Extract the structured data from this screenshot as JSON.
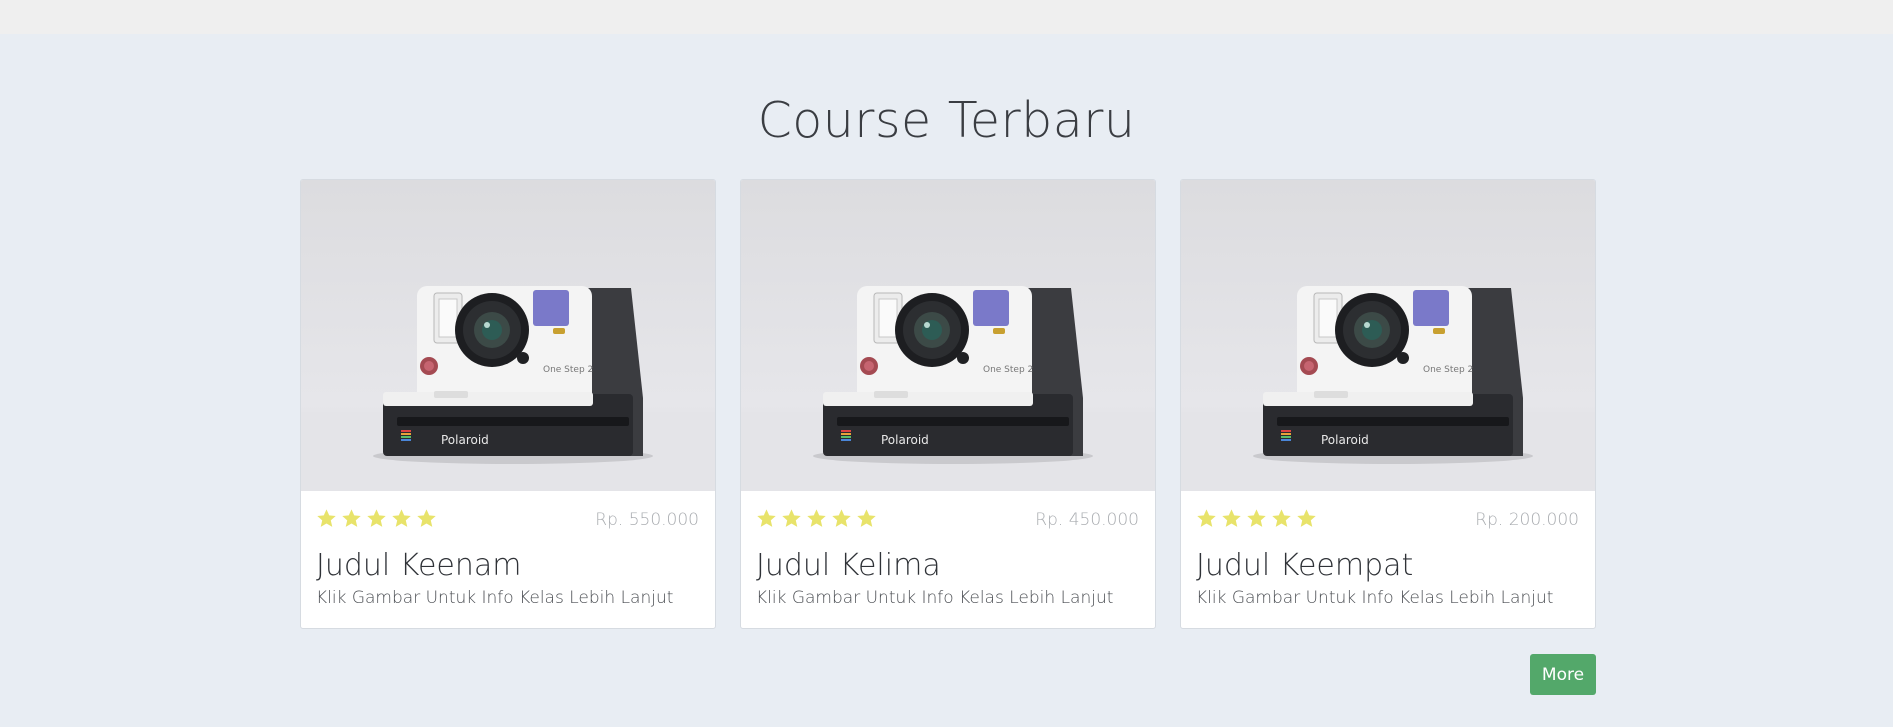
{
  "section": {
    "title": "Course Terbaru"
  },
  "courses": [
    {
      "rating": 5,
      "price": "Rp. 550.000",
      "title": "Judul Keenam",
      "subtitle": "Klik Gambar Untuk Info Kelas Lebih Lanjut",
      "image": "polaroid-camera-photo",
      "brand_text": "Polaroid",
      "model_text": "One Step 2"
    },
    {
      "rating": 5,
      "price": "Rp. 450.000",
      "title": "Judul Kelima",
      "subtitle": "Klik Gambar Untuk Info Kelas Lebih Lanjut",
      "image": "polaroid-camera-photo",
      "brand_text": "Polaroid",
      "model_text": "One Step 2"
    },
    {
      "rating": 5,
      "price": "Rp. 200.000",
      "title": "Judul Keempat",
      "subtitle": "Klik Gambar Untuk Info Kelas Lebih Lanjut",
      "image": "polaroid-camera-photo",
      "brand_text": "Polaroid",
      "model_text": "One Step 2"
    }
  ],
  "actions": {
    "more_label": "More"
  },
  "colors": {
    "page_background": "#e8edf3",
    "top_bar": "#efefef",
    "star": "#e8e36a",
    "more_button": "#53a86a",
    "price_text": "#a9acb0"
  },
  "icons": {
    "rating": "star-icon"
  }
}
